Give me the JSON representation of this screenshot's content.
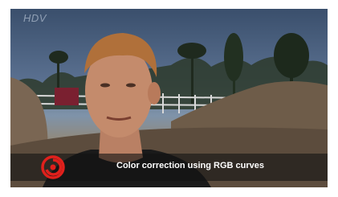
{
  "video": {
    "watermark": "HDV",
    "caption": "Color correction using RGB curves"
  },
  "icons": {
    "logo": "red-swirl-logo-icon"
  },
  "colors": {
    "caption_bar": "#141414",
    "caption_text": "#ffffff",
    "logo_red": "#e0201c"
  }
}
